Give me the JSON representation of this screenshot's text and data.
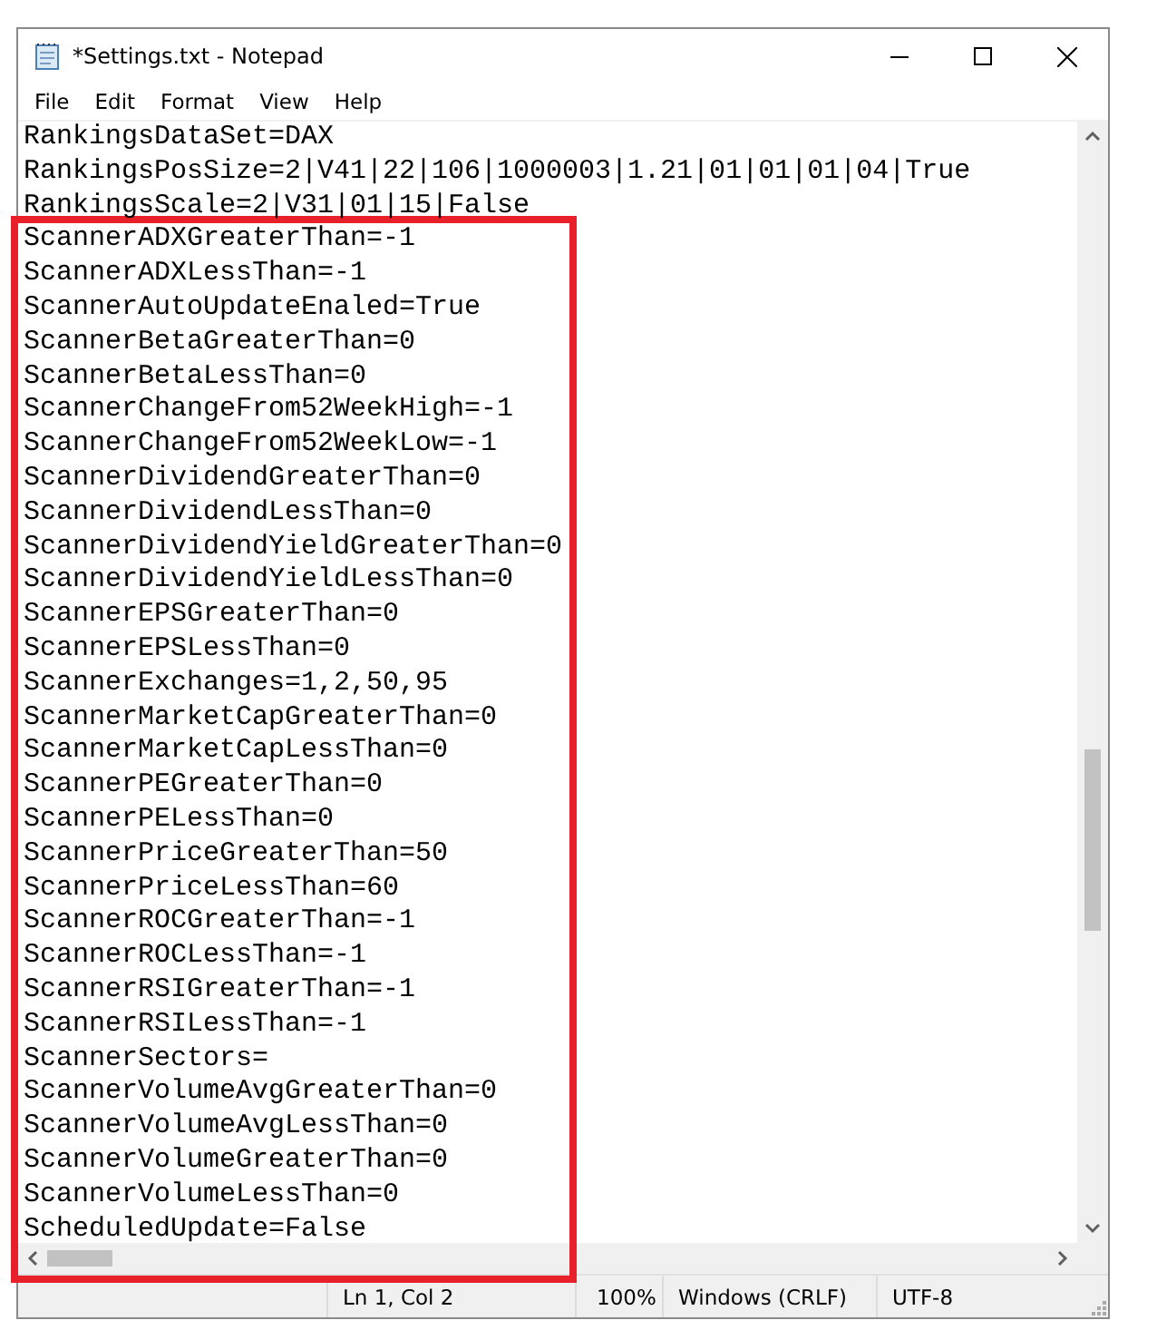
{
  "window": {
    "title": "*Settings.txt - Notepad"
  },
  "menu": [
    "File",
    "Edit",
    "Format",
    "View",
    "Help"
  ],
  "lines": [
    "RankingsDataSet=DAX",
    "RankingsPosSize=2|V41|22|106|1000003|1.21|01|01|01|04|True",
    "RankingsScale=2|V31|01|15|False",
    "ScannerADXGreaterThan=-1",
    "ScannerADXLessThan=-1",
    "ScannerAutoUpdateEnaled=True",
    "ScannerBetaGreaterThan=0",
    "ScannerBetaLessThan=0",
    "ScannerChangeFrom52WeekHigh=-1",
    "ScannerChangeFrom52WeekLow=-1",
    "ScannerDividendGreaterThan=0",
    "ScannerDividendLessThan=0",
    "ScannerDividendYieldGreaterThan=0",
    "ScannerDividendYieldLessThan=0",
    "ScannerEPSGreaterThan=0",
    "ScannerEPSLessThan=0",
    "ScannerExchanges=1,2,50,95",
    "ScannerMarketCapGreaterThan=0",
    "ScannerMarketCapLessThan=0",
    "ScannerPEGreaterThan=0",
    "ScannerPELessThan=0",
    "ScannerPriceGreaterThan=50",
    "ScannerPriceLessThan=60",
    "ScannerROCGreaterThan=-1",
    "ScannerROCLessThan=-1",
    "ScannerRSIGreaterThan=-1",
    "ScannerRSILessThan=-1",
    "ScannerSectors=",
    "ScannerVolumeAvgGreaterThan=0",
    "ScannerVolumeAvgLessThan=0",
    "ScannerVolumeGreaterThan=0",
    "ScannerVolumeLessThan=0",
    "ScheduledUpdate=False"
  ],
  "status_bar": {
    "position": "Ln 1, Col 2",
    "zoom": "100%",
    "line_endings": "Windows (CRLF)",
    "encoding": "UTF-8"
  }
}
